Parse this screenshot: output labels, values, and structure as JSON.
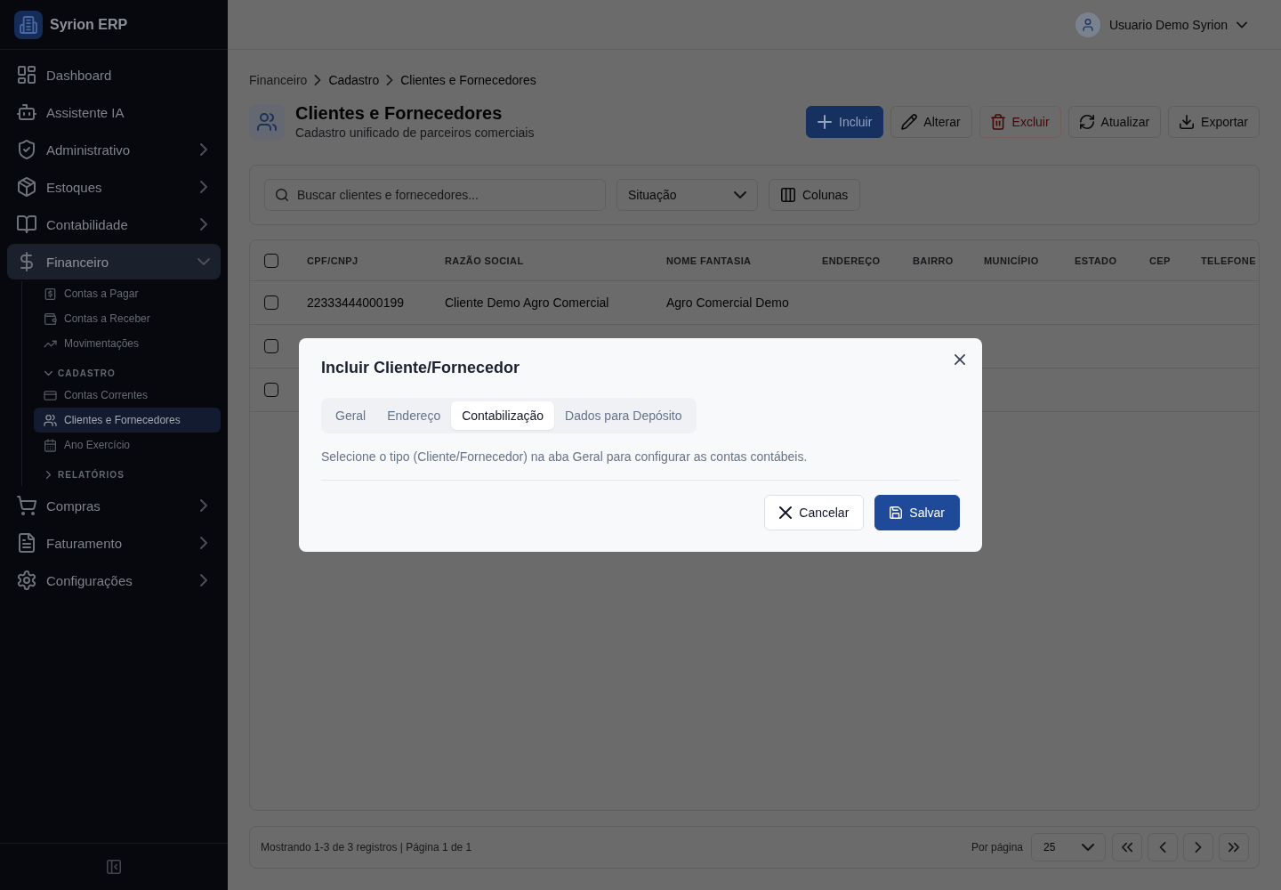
{
  "sidebar": {
    "brand": "Syrion ERP",
    "nav": [
      {
        "label": "Dashboard",
        "selected": false
      },
      {
        "label": "Assistente IA",
        "selected": false
      },
      {
        "label": "Administrativo",
        "selected": false,
        "expanded": false
      },
      {
        "label": "Estoques",
        "selected": false,
        "expanded": false
      },
      {
        "label": "Contabilidade",
        "selected": false,
        "expanded": false
      },
      {
        "label": "Financeiro",
        "selected": true,
        "expanded": true,
        "children": [
          {
            "kind": "link",
            "label": "Contas a Pagar",
            "selected": false
          },
          {
            "kind": "link",
            "label": "Contas a Receber",
            "selected": false
          },
          {
            "kind": "link",
            "label": "Movimentações",
            "selected": false
          },
          {
            "kind": "section",
            "label": "CADASTRO",
            "expanded": true,
            "children": [
              {
                "kind": "link",
                "label": "Contas Correntes",
                "selected": false
              },
              {
                "kind": "link",
                "label": "Clientes e Fornecedores",
                "selected": true
              },
              {
                "kind": "link",
                "label": "Ano Exercício",
                "selected": false
              }
            ]
          },
          {
            "kind": "section",
            "label": "RELATÓRIOS",
            "expanded": false
          }
        ]
      },
      {
        "label": "Compras",
        "selected": false,
        "expanded": false
      },
      {
        "label": "Faturamento",
        "selected": false,
        "expanded": false
      },
      {
        "label": "Configurações",
        "selected": false,
        "expanded": false
      }
    ]
  },
  "header": {
    "user": "Usuario Demo Syrion"
  },
  "breadcrumb": [
    {
      "label": "Financeiro",
      "muted": true
    },
    {
      "label": "Cadastro",
      "muted": false
    },
    {
      "label": "Clientes e Fornecedores",
      "muted": false
    }
  ],
  "page": {
    "title": "Clientes e Fornecedores",
    "subtitle": "Cadastro unificado de parceiros comerciais",
    "actions": [
      {
        "label": "Incluir",
        "kind": "primary"
      },
      {
        "label": "Alterar",
        "kind": "default"
      },
      {
        "label": "Excluir",
        "kind": "danger"
      },
      {
        "label": "Atualizar",
        "kind": "default"
      },
      {
        "label": "Exportar",
        "kind": "default"
      }
    ]
  },
  "filters": {
    "search": {
      "placeholder": "Buscar clientes e fornecedores..."
    },
    "status": {
      "value": "Situação"
    },
    "columns_button": "Colunas"
  },
  "table": {
    "select_all": {
      "checked": false
    },
    "columns": [
      "CPF/CNPJ",
      "RAZÃO SOCIAL",
      "NOME FANTASIA",
      "ENDEREÇO",
      "BAIRRO",
      "MUNICÍPIO",
      "ESTADO",
      "CEP",
      "TELEFONE"
    ],
    "rows": [
      {
        "checked": false,
        "cells": [
          "22333444000199",
          "Cliente Demo Agro Comercial",
          "Agro Comercial Demo"
        ]
      },
      {
        "checked": false
      },
      {
        "checked": false
      }
    ]
  },
  "pagination": {
    "summary": "Mostrando 1-3 de 3 registros | Página 1 de 1",
    "per_page_label": "Por página",
    "per_page": "25"
  },
  "dialog": {
    "title": "Incluir Cliente/Fornecedor",
    "tabs": [
      {
        "label": "Geral",
        "selected": false
      },
      {
        "label": "Endereço",
        "selected": false
      },
      {
        "label": "Contabilização",
        "selected": true
      },
      {
        "label": "Dados para Depósito",
        "selected": false
      }
    ],
    "message": "Selecione o tipo (Cliente/Fornecedor) na aba Geral para configurar as contas contábeis.",
    "buttons": [
      {
        "label": "Cancelar",
        "kind": "secondary"
      },
      {
        "label": "Salvar",
        "kind": "primary"
      }
    ]
  }
}
